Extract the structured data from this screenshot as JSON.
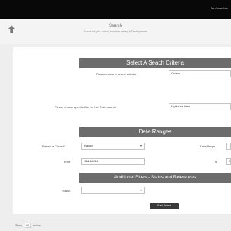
{
  "topbar": {
    "brand": "MerHouse Inter"
  },
  "header": {
    "title": "Search",
    "subtitle": "Search for your orders, shadows testing & Developments"
  },
  "sections": {
    "criteria": "Select A Seach Criteria",
    "dates": "Date Ranges",
    "filters": "Additional Filters - Status and References"
  },
  "criteria": {
    "search_label": "Please choose a search criteria",
    "search_value": "Orders",
    "filter_label": "Please choose specific filter for this Order search",
    "filter_value": "MyHouse Inter"
  },
  "dates": {
    "type_label": "Raised or Closed?",
    "type_value": "Raised",
    "range_label": "Date Range",
    "range_value": "T",
    "from_label": "From",
    "from_value": "16/12/2016",
    "to_label": "To",
    "to_value": "0"
  },
  "filters": {
    "status_label": "Status",
    "status_value": ""
  },
  "buttons": {
    "search": "Start Search"
  },
  "pager": {
    "show_label": "Show",
    "page_size": "10",
    "entries_label": "entries"
  }
}
